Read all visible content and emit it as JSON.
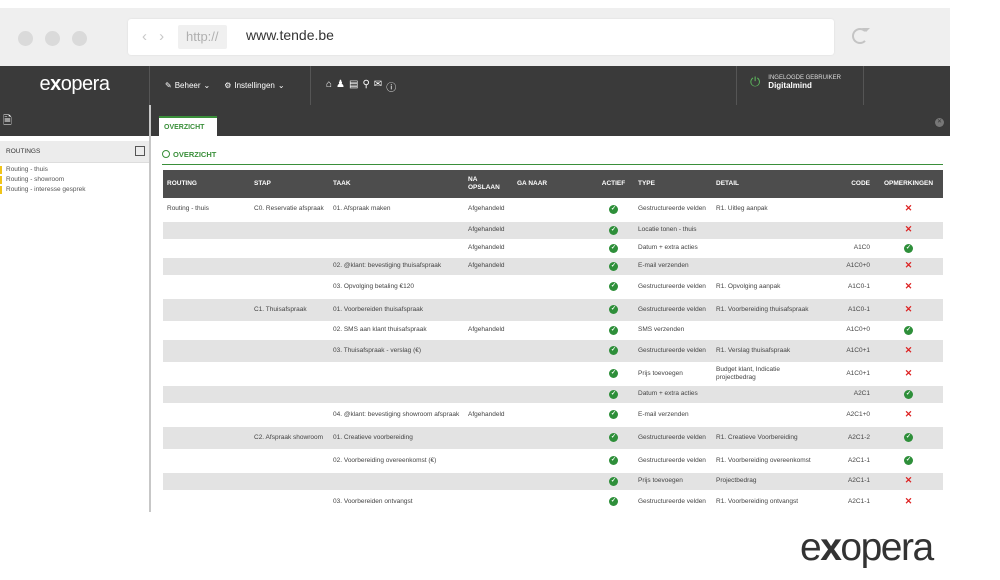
{
  "browser": {
    "nav_arrows": "‹ ›",
    "scheme": "http://",
    "url": "www.tende.be"
  },
  "logo": {
    "pre": "e",
    "bold": "x",
    "post": "opera"
  },
  "nav": {
    "beheer": "Beheer",
    "instellingen": "Instellingen",
    "quick_icons": [
      "home-icon",
      "user-icon",
      "calendar-icon",
      "map-pin-icon",
      "mail-icon",
      "info-icon"
    ],
    "user_label": "INGELOGDE GEBRUIKER",
    "user_name": "Digitalmind"
  },
  "sidebar": {
    "heading": "ROUTINGS",
    "items": [
      "Routing - thuis",
      "Routing - showroom",
      "Routing - interesse gesprek"
    ]
  },
  "tab": {
    "label": "OVERZICHT"
  },
  "section": {
    "title": "OVERZICHT"
  },
  "table": {
    "headers": [
      "ROUTING",
      "STAP",
      "TAAK",
      "NA OPSLAAN",
      "GA NAAR",
      "ACTIEF",
      "TYPE",
      "DETAIL",
      "CODE",
      "OPMERKINGEN"
    ],
    "rows": [
      {
        "alt": false,
        "routing": "Routing - thuis",
        "stap": "C0. Reservatie afspraak",
        "taak": "01. Afspraak maken",
        "na": "Afgehandeld",
        "ga": "",
        "actief": true,
        "type": "Gestructureerde velden",
        "detail": "R1. Uitleg aanpak",
        "code": "",
        "opm": false
      },
      {
        "alt": true,
        "routing": "",
        "stap": "",
        "taak": "",
        "na": "Afgehandeld",
        "ga": "",
        "actief": true,
        "type": "Locatie tonen - thuis",
        "detail": "",
        "code": "",
        "opm": false
      },
      {
        "alt": false,
        "routing": "",
        "stap": "",
        "taak": "",
        "na": "Afgehandeld",
        "ga": "",
        "actief": true,
        "type": "Datum + extra acties",
        "detail": "",
        "code": "A1C0",
        "opm": true
      },
      {
        "alt": true,
        "routing": "",
        "stap": "",
        "taak": "02. @klant: bevestiging thuisafspraak",
        "na": "Afgehandeld",
        "ga": "",
        "actief": true,
        "type": "E-mail verzenden",
        "detail": "",
        "code": "A1C0+0",
        "opm": false
      },
      {
        "alt": false,
        "routing": "",
        "stap": "",
        "taak": "03. Opvolging betaling €120",
        "na": "",
        "ga": "",
        "actief": true,
        "type": "Gestructureerde velden",
        "detail": "R1. Opvolging aanpak",
        "code": "A1C0-1",
        "opm": false
      },
      {
        "alt": true,
        "routing": "",
        "stap": "C1. Thuisafspraak",
        "taak": "01. Voorbereiden thuisafspraak",
        "na": "",
        "ga": "",
        "actief": true,
        "type": "Gestructureerde velden",
        "detail": "R1. Voorbereiding thuisafspraak",
        "code": "A1C0-1",
        "opm": false
      },
      {
        "alt": false,
        "routing": "",
        "stap": "",
        "taak": "02. SMS aan klant thuisafspraak",
        "na": "Afgehandeld",
        "ga": "",
        "actief": true,
        "type": "SMS verzenden",
        "detail": "",
        "code": "A1C0+0",
        "opm": true
      },
      {
        "alt": true,
        "routing": "",
        "stap": "",
        "taak": "03. Thuisafspraak - verslag (€)",
        "na": "",
        "ga": "",
        "actief": true,
        "type": "Gestructureerde velden",
        "detail": "R1. Verslag thuisafspraak",
        "code": "A1C0+1",
        "opm": false
      },
      {
        "alt": false,
        "routing": "",
        "stap": "",
        "taak": "",
        "na": "",
        "ga": "",
        "actief": true,
        "type": "Prijs toevoegen",
        "detail": "Budget klant, Indicatie projectbedrag",
        "code": "A1C0+1",
        "opm": false
      },
      {
        "alt": true,
        "routing": "",
        "stap": "",
        "taak": "",
        "na": "",
        "ga": "",
        "actief": true,
        "type": "Datum + extra acties",
        "detail": "",
        "code": "A2C1",
        "opm": true
      },
      {
        "alt": false,
        "routing": "",
        "stap": "",
        "taak": "04. @klant: bevestiging showroom afspraak",
        "na": "Afgehandeld",
        "ga": "",
        "actief": true,
        "type": "E-mail verzenden",
        "detail": "",
        "code": "A2C1+0",
        "opm": false
      },
      {
        "alt": true,
        "routing": "",
        "stap": "C2. Afspraak showroom",
        "taak": "01. Creatieve voorbereiding",
        "na": "",
        "ga": "",
        "actief": true,
        "type": "Gestructureerde velden",
        "detail": "R1. Creatieve Voorbereiding",
        "code": "A2C1-2",
        "opm": true
      },
      {
        "alt": false,
        "routing": "",
        "stap": "",
        "taak": "02. Voorbereiding overeenkomst (€)",
        "na": "",
        "ga": "",
        "actief": true,
        "type": "Gestructureerde velden",
        "detail": "R1. Voorbereiding overeenkomst",
        "code": "A2C1-1",
        "opm": true
      },
      {
        "alt": true,
        "routing": "",
        "stap": "",
        "taak": "",
        "na": "",
        "ga": "",
        "actief": true,
        "type": "Prijs toevoegen",
        "detail": "Projectbedrag",
        "code": "A2C1-1",
        "opm": false
      },
      {
        "alt": false,
        "routing": "",
        "stap": "",
        "taak": "03. Voorbereiden ontvangst",
        "na": "",
        "ga": "",
        "actief": true,
        "type": "Gestructureerde velden",
        "detail": "R1. Voorbereiding ontvangst",
        "code": "A2C1-1",
        "opm": false
      }
    ]
  },
  "colors": {
    "accent": "#3a8f3a",
    "ok": "#2e8f3a",
    "error": "#dd2222",
    "dark": "#3a3a3a"
  }
}
